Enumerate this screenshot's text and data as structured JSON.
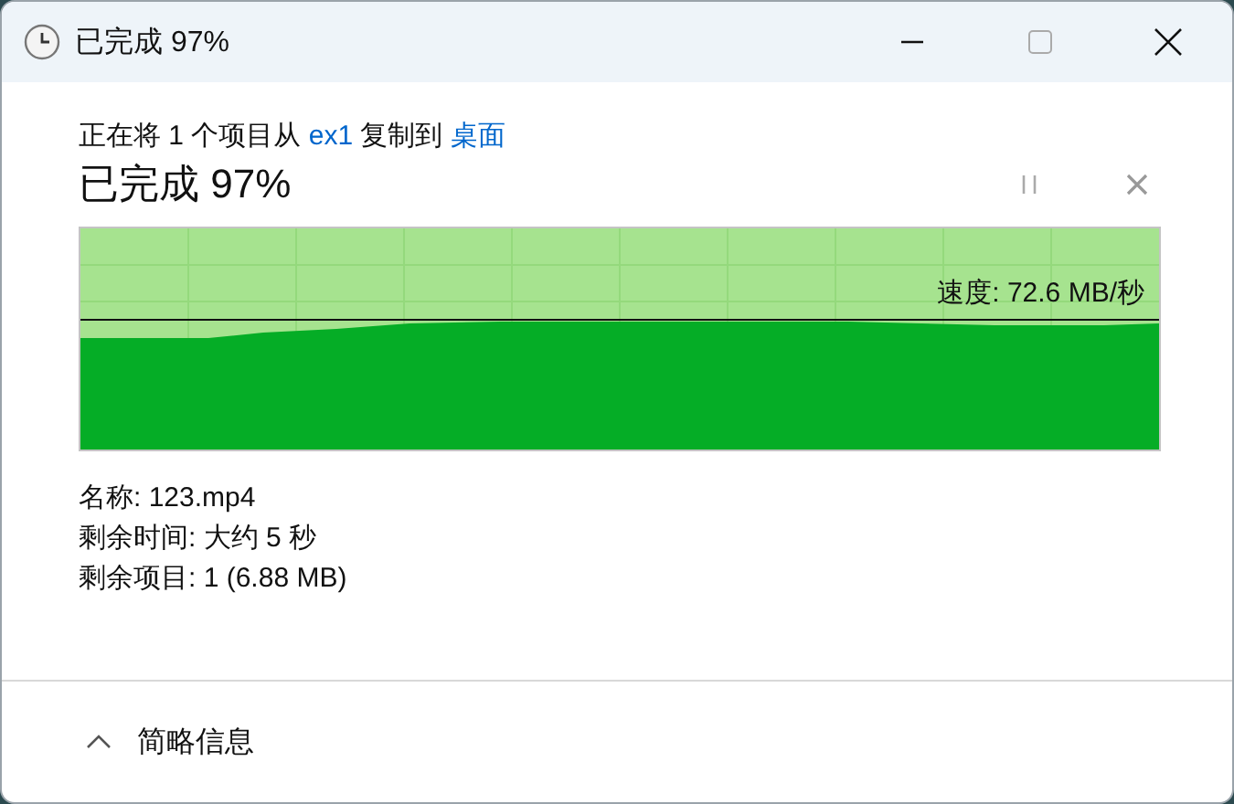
{
  "window": {
    "title": "已完成 97%"
  },
  "header": {
    "prefix": "正在将 1 个项目从",
    "source": "ex1",
    "middle": "复制到",
    "destination": "桌面"
  },
  "status": "已完成 97%",
  "progress": {
    "level": 1,
    "speed": "速度: 72.6 MB/秒"
  },
  "details": [
    "名称: 123.mp4",
    "剩余时间: 大约 5 秒",
    "剩余项目: 1 (6.88 MB)"
  ],
  "footer": {
    "toggle": "简略信息",
    "expanded": true
  }
}
